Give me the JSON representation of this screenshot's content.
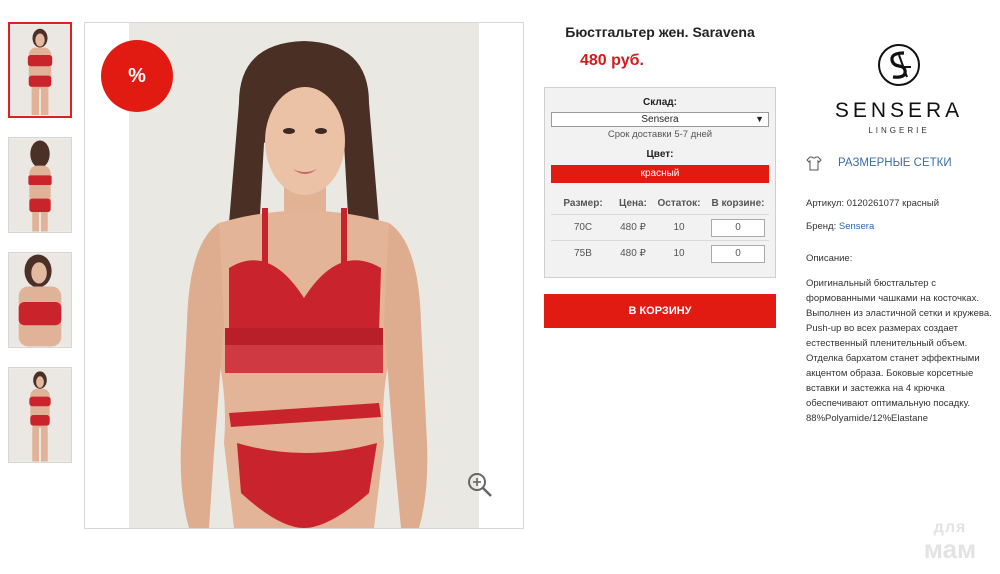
{
  "gallery": {
    "thumbnails": [
      {
        "alt": "front-full",
        "active": true
      },
      {
        "alt": "back",
        "active": false
      },
      {
        "alt": "closeup",
        "active": false
      },
      {
        "alt": "front-full-2",
        "active": false
      }
    ],
    "sale_badge": "%",
    "zoom_icon": "zoom-in-icon"
  },
  "product": {
    "title": "Бюстгальтер жен. Saravena",
    "price": "480 руб."
  },
  "stock": {
    "warehouse_label": "Склад:",
    "warehouse_value": "Sensera",
    "delivery": "Срок доставки 5-7 дней",
    "color_label": "Цвет:",
    "color_value": "красный",
    "columns": [
      "Размер:",
      "Цена:",
      "Остаток:",
      "В корзине:"
    ],
    "rows": [
      {
        "size": "70C",
        "price": "480 ₽",
        "stock": "10",
        "qty": "0"
      },
      {
        "size": "75B",
        "price": "480 ₽",
        "stock": "10",
        "qty": "0"
      }
    ]
  },
  "cart_button": "В КОРЗИНУ",
  "brand": {
    "name": "SENSERA",
    "sub": "LINGERIE"
  },
  "size_chart_link": "РАЗМЕРНЫЕ СЕТКИ",
  "details": {
    "article_label": "Артикул:",
    "article_value": "0120261077 красный",
    "brand_label": "Бренд:",
    "brand_value": "Sensera",
    "description_label": "Описание:",
    "description": "Оригинальный бюстгальтер с формованными чашками на косточках. Выполнен из эластичной сетки и кружева. Push-up во всех размерах создает естественный пленительный объем. Отделка бархатом станет эффектными акцентом образа. Боковые корсетные вставки и застежка на 4 крючка обеспечивают оптимальную посадку. 88%Polyamide/12%Elastane"
  },
  "watermark": {
    "line1": "для",
    "line2": "мам"
  },
  "colors": {
    "accent": "#e21b12",
    "link": "#3a6fa8",
    "price": "#d21a1a"
  }
}
